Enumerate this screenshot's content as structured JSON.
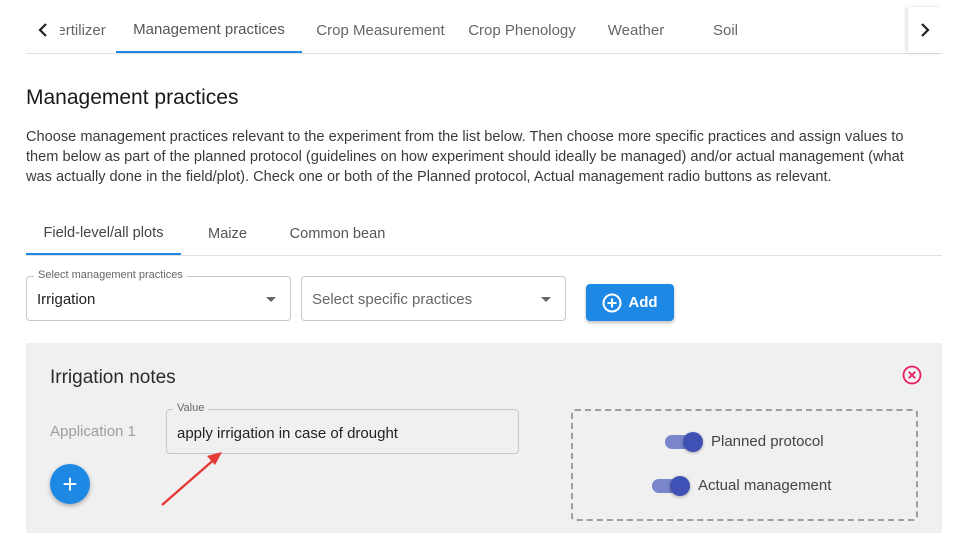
{
  "top_tabs": [
    {
      "label": "Fertilizer",
      "active": false
    },
    {
      "label": "Management practices",
      "active": true
    },
    {
      "label": "Crop Measurement",
      "active": false
    },
    {
      "label": "Crop Phenology",
      "active": false
    },
    {
      "label": "Weather",
      "active": false
    },
    {
      "label": "Soil",
      "active": false
    }
  ],
  "page": {
    "title": "Management practices",
    "description": "Choose management practices relevant to the experiment from the list below. Then choose more specific practices and assign values to them below as part of the planned protocol (guidelines on how experiment should ideally be managed) and/or actual management (what was actually done in the field/plot). Check one or both of the Planned protocol, Actual management radio buttons as relevant."
  },
  "crop_tabs": [
    {
      "label": "Field-level/all plots",
      "active": true
    },
    {
      "label": "Maize",
      "active": false
    },
    {
      "label": "Common bean",
      "active": false
    }
  ],
  "selectors": {
    "practices_label": "Select management practices",
    "practices_value": "Irrigation",
    "specific_placeholder": "Select specific practices",
    "add_label": "Add"
  },
  "notes_panel": {
    "title": "Irrigation notes",
    "application_label": "Application 1",
    "value_label": "Value",
    "value_text": "apply irrigation in case of drought",
    "add_symbol": "+",
    "toggles": [
      {
        "label": "Planned protocol",
        "on": true
      },
      {
        "label": "Actual management",
        "on": true
      }
    ]
  },
  "colors": {
    "accent": "#1e88e5",
    "switch_track": "#7986cb",
    "switch_knob": "#3f51b5",
    "close_icon": "#e91e63",
    "annotation_arrow": "#e53935"
  },
  "icons": {
    "left": "chevron-left-icon",
    "right": "chevron-right-icon",
    "add": "plus-circle-icon",
    "close": "close-circle-icon",
    "annotation": "red-arrow-icon"
  }
}
